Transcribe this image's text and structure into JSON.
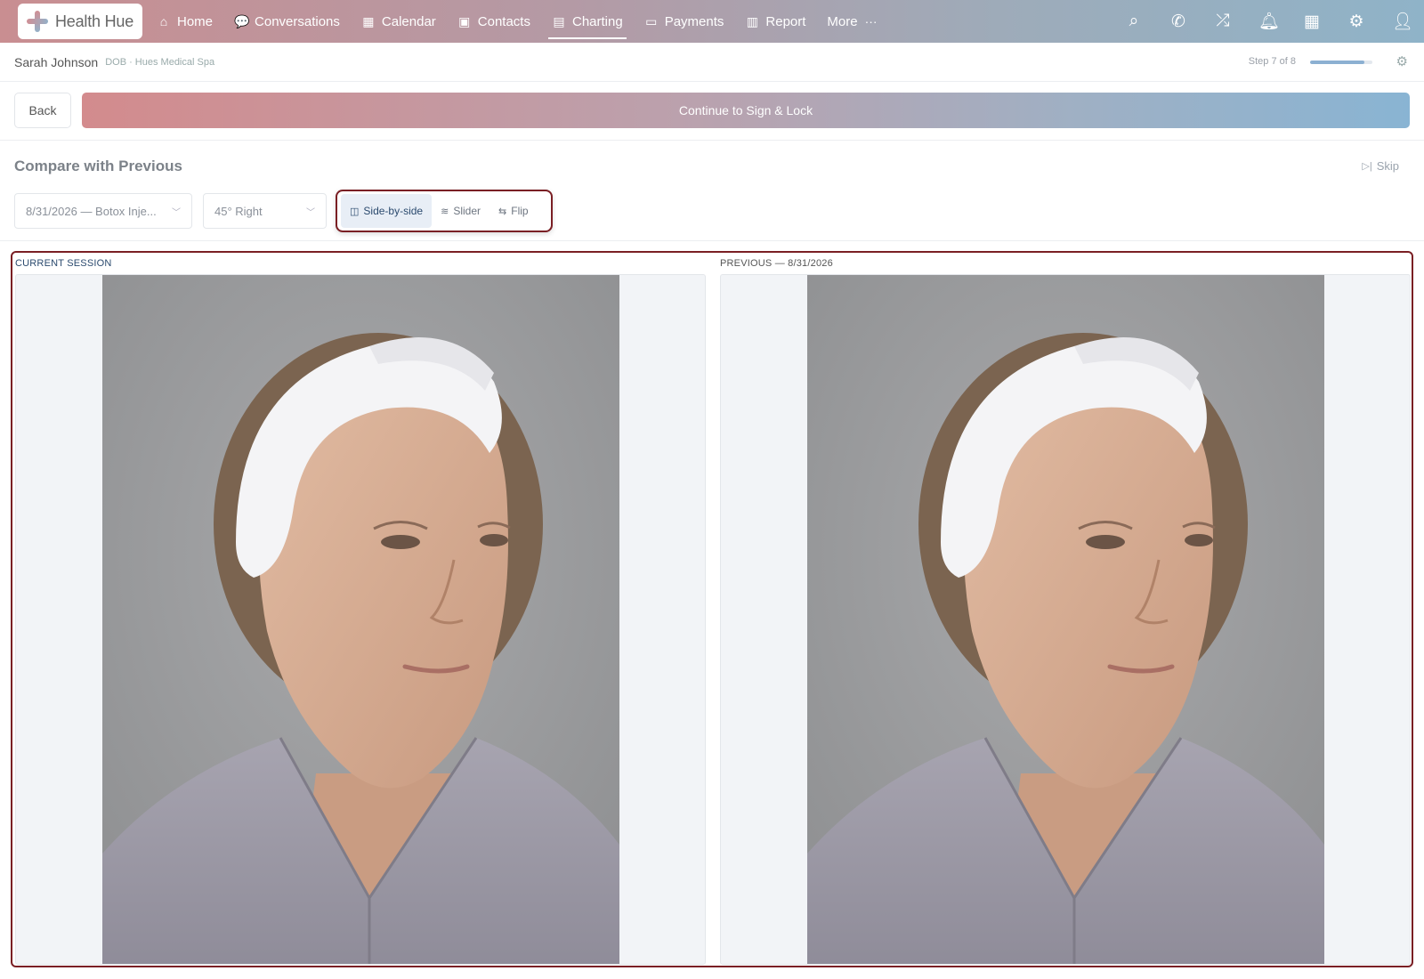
{
  "app": {
    "name": "Health Hue"
  },
  "nav": {
    "items": [
      {
        "label": "Home",
        "icon": "home-icon",
        "glyph": "⌂"
      },
      {
        "label": "Conversations",
        "icon": "chat-icon",
        "glyph": "💬"
      },
      {
        "label": "Calendar",
        "icon": "calendar-icon",
        "glyph": "▦"
      },
      {
        "label": "Contacts",
        "icon": "contact-card-icon",
        "glyph": "▣"
      },
      {
        "label": "Charting",
        "icon": "document-icon",
        "glyph": "▤"
      },
      {
        "label": "Payments",
        "icon": "credit-card-icon",
        "glyph": "▭"
      },
      {
        "label": "Report",
        "icon": "bar-chart-icon",
        "glyph": "▥"
      },
      {
        "label": "More",
        "icon": "more-dots-icon",
        "glyph": "···"
      }
    ],
    "active": "Charting",
    "right_icons": [
      "search-icon",
      "phone-icon",
      "shuffle-icon",
      "bell-icon",
      "calendar-icon",
      "gear-icon",
      "user-icon"
    ]
  },
  "patient": {
    "name": "Sarah Johnson",
    "meta": "DOB · Hues Medical Spa",
    "step_text": "Step 7 of 8",
    "progress": 0.875
  },
  "actions": {
    "back_label": "Back",
    "continue_label": "Continue to Sign & Lock"
  },
  "compare": {
    "title": "Compare with Previous",
    "skip_label": "Skip",
    "session_select": "8/31/2026 — Botox Inje...",
    "angle_select": "45° Right",
    "modes": [
      {
        "label": "Side-by-side",
        "icon": "columns-icon"
      },
      {
        "label": "Slider",
        "icon": "layers-icon"
      },
      {
        "label": "Flip",
        "icon": "swap-icon"
      }
    ],
    "active_mode": "Side-by-side",
    "current_label": "CURRENT SESSION",
    "previous_label": "PREVIOUS — 8/31/2026"
  },
  "colors": {
    "accent": "#2b4a6e",
    "highlight_border": "#7a1f24",
    "nav_gradient_start": "#c98e91",
    "nav_gradient_end": "#8fb3c8"
  }
}
